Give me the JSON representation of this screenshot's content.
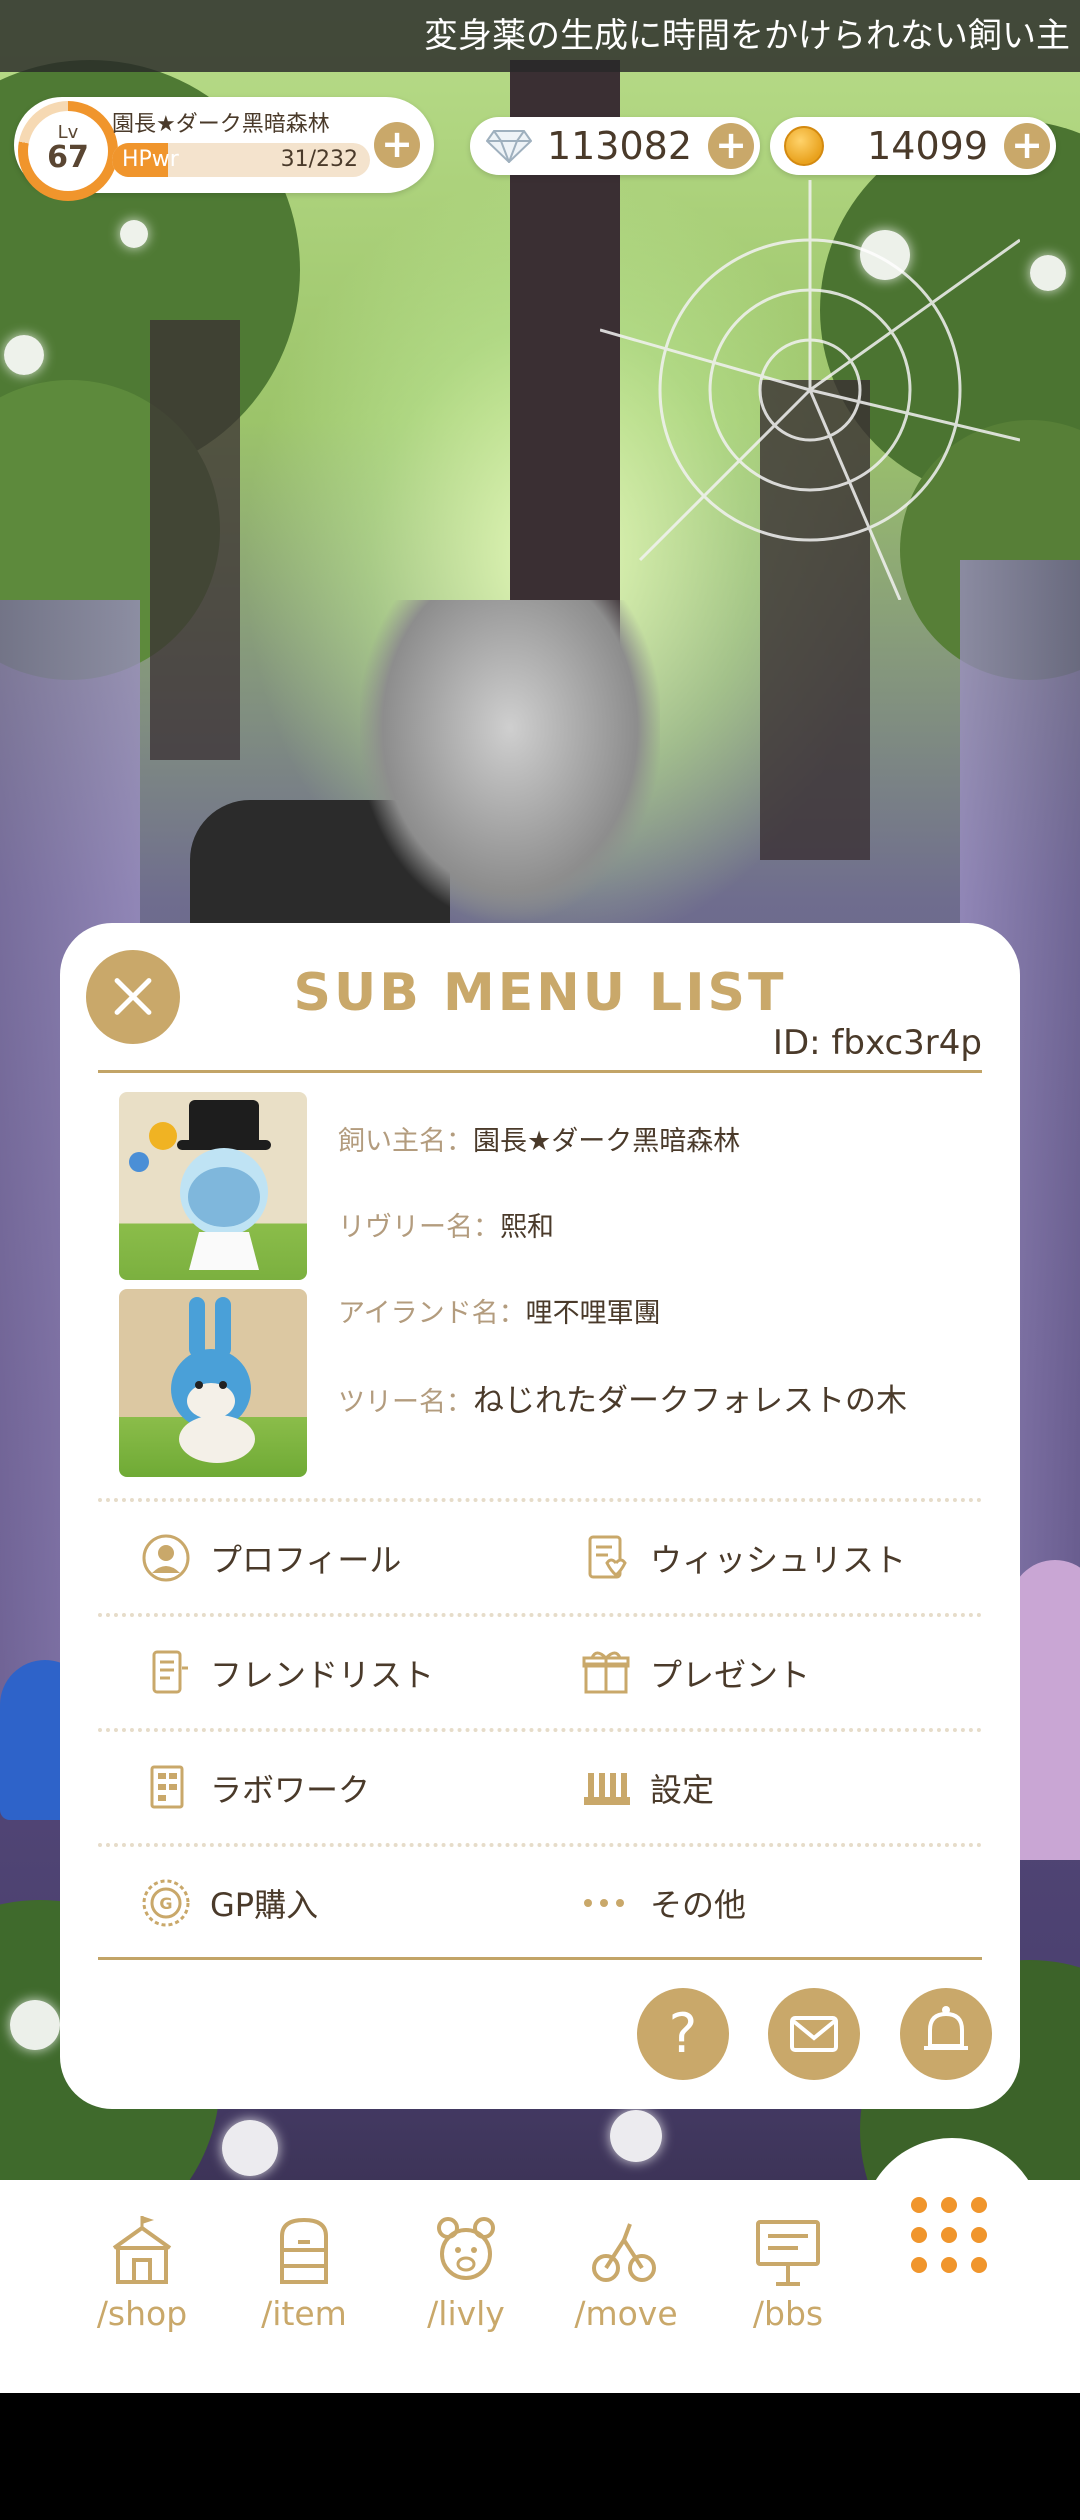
{
  "marquee": {
    "text": "変身薬の生成に時間をかけられない飼い主"
  },
  "status": {
    "level_label": "Lv",
    "level": "67",
    "player_name": "園長★ダーク黑暗森林",
    "hp_label": "HPwr",
    "hp_value": "31/232",
    "hp_fraction": 0.134,
    "gems": "113082",
    "coins": "14099"
  },
  "submenu": {
    "title": "SUB MENU LIST",
    "id_text": "ID: fbxc3r4p",
    "info": [
      {
        "label": "飼い主名：",
        "value": "園長★ダーク黑暗森林"
      },
      {
        "label": "リヴリー名：",
        "value": "熙和"
      },
      {
        "label": "アイランド名：",
        "value": "哩不哩軍團"
      },
      {
        "label": "ツリー名：",
        "value": "ねじれたダークフォレストの木"
      }
    ],
    "items": [
      {
        "label": "プロフィール",
        "icon": "profile-icon"
      },
      {
        "label": "ウィッシュリスト",
        "icon": "wishlist-icon"
      },
      {
        "label": "フレンドリスト",
        "icon": "friendlist-icon"
      },
      {
        "label": "プレゼント",
        "icon": "present-icon"
      },
      {
        "label": "ラボワーク",
        "icon": "labwork-icon"
      },
      {
        "label": "設定",
        "icon": "settings-icon"
      },
      {
        "label": "GP購入",
        "icon": "gp-icon"
      },
      {
        "label": "その他",
        "icon": "more-icon"
      }
    ],
    "help_glyph": "?"
  },
  "nav": [
    {
      "label": "/shop",
      "icon": "shop-icon"
    },
    {
      "label": "/item",
      "icon": "item-icon"
    },
    {
      "label": "/livly",
      "icon": "livly-icon"
    },
    {
      "label": "/move",
      "icon": "move-icon"
    },
    {
      "label": "/bbs",
      "icon": "bbs-icon"
    }
  ],
  "colors": {
    "accent_gold": "#c9a86a",
    "accent_orange": "#f0952c",
    "text_brown": "#4a3a2a",
    "label_tan": "#b39c7e"
  }
}
